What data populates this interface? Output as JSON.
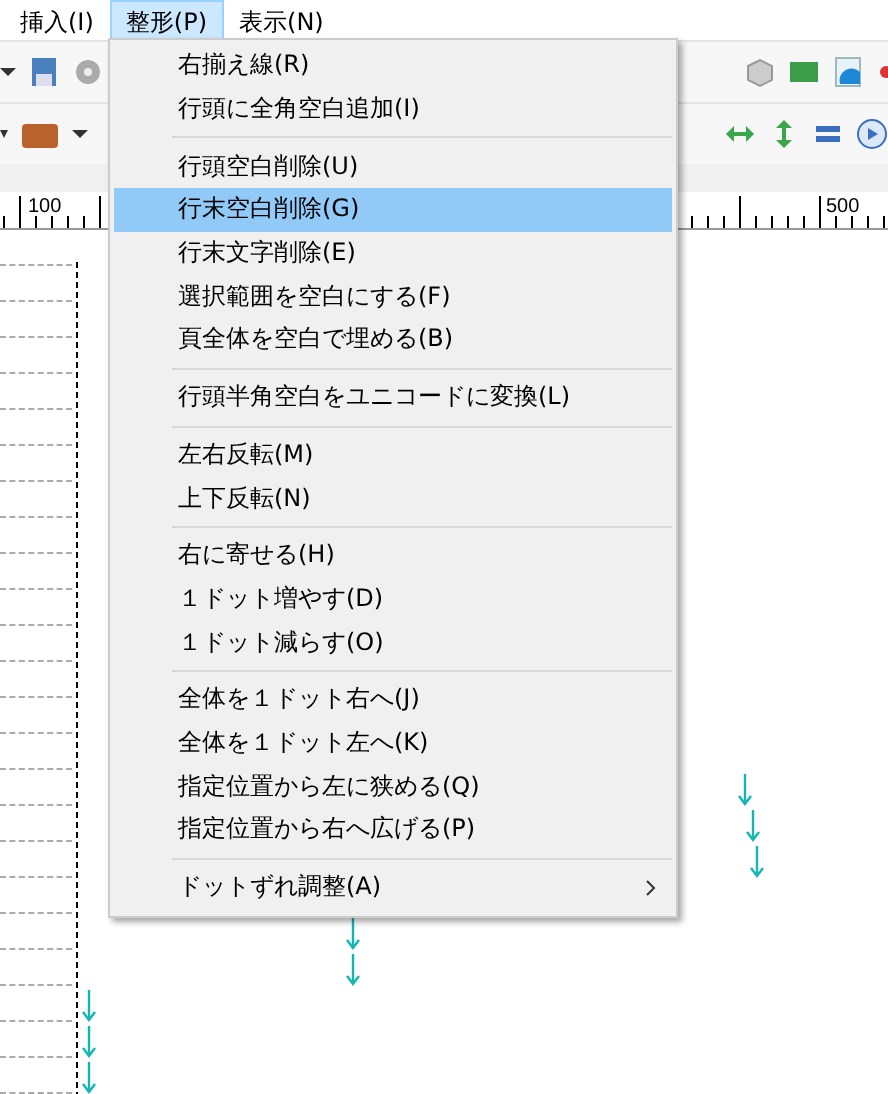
{
  "menubar": [
    {
      "label": "挿入(I)",
      "selected": false
    },
    {
      "label": "整形(P)",
      "selected": true
    },
    {
      "label": "表示(N)",
      "selected": false
    }
  ],
  "ruler": {
    "labels": [
      "100",
      "500"
    ]
  },
  "menu": {
    "items": [
      {
        "kind": "item",
        "label": "右揃え線(R)",
        "selected": false
      },
      {
        "kind": "item",
        "label": "行頭に全角空白追加(I)",
        "selected": false
      },
      {
        "kind": "separator"
      },
      {
        "kind": "item",
        "label": "行頭空白削除(U)",
        "selected": false
      },
      {
        "kind": "item",
        "label": "行末空白削除(G)",
        "selected": true
      },
      {
        "kind": "item",
        "label": "行末文字削除(E)",
        "selected": false
      },
      {
        "kind": "item",
        "label": "選択範囲を空白にする(F)",
        "selected": false
      },
      {
        "kind": "item",
        "label": "頁全体を空白で埋める(B)",
        "selected": false
      },
      {
        "kind": "separator"
      },
      {
        "kind": "item",
        "label": "行頭半角空白をユニコードに変換(L)",
        "selected": false
      },
      {
        "kind": "separator"
      },
      {
        "kind": "item",
        "label": "左右反転(M)",
        "selected": false
      },
      {
        "kind": "item",
        "label": "上下反転(N)",
        "selected": false
      },
      {
        "kind": "separator"
      },
      {
        "kind": "item",
        "label": "右に寄せる(H)",
        "selected": false
      },
      {
        "kind": "item",
        "label": "１ドット増やす(D)",
        "selected": false
      },
      {
        "kind": "item",
        "label": "１ドット減らす(O)",
        "selected": false
      },
      {
        "kind": "separator"
      },
      {
        "kind": "item",
        "label": "全体を１ドット右へ(J)",
        "selected": false
      },
      {
        "kind": "item",
        "label": "全体を１ドット左へ(K)",
        "selected": false
      },
      {
        "kind": "item",
        "label": "指定位置から左に狭める(Q)",
        "selected": false
      },
      {
        "kind": "item",
        "label": "指定位置から右へ広げる(P)",
        "selected": false
      },
      {
        "kind": "separator"
      },
      {
        "kind": "submenu",
        "label": "ドットずれ調整(A)",
        "selected": false
      }
    ]
  }
}
